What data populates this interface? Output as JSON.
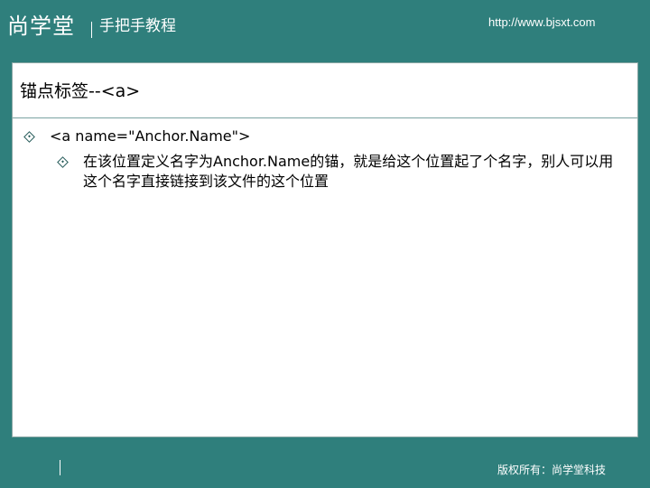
{
  "header": {
    "brand": "尚学堂",
    "subtitle": "手把手教程",
    "url": "http://www.bjsxt.com"
  },
  "slide": {
    "title": "锚点标签--<a>",
    "bullets": [
      {
        "text": "<a name=\"Anchor.Name\">"
      },
      {
        "text": "在该位置定义名字为Anchor.Name的锚，就是给这个位置起了个名字，别人可以用这个名字直接链接到该文件的这个位置"
      }
    ]
  },
  "footer": {
    "copyright": "版权所有：尚学堂科技"
  },
  "colors": {
    "frame": "#2f7f7c",
    "panel": "#ffffff",
    "bullet": "#245a58",
    "text": "#000000"
  },
  "icons": {
    "bullet": "diamond-bullet-icon"
  }
}
